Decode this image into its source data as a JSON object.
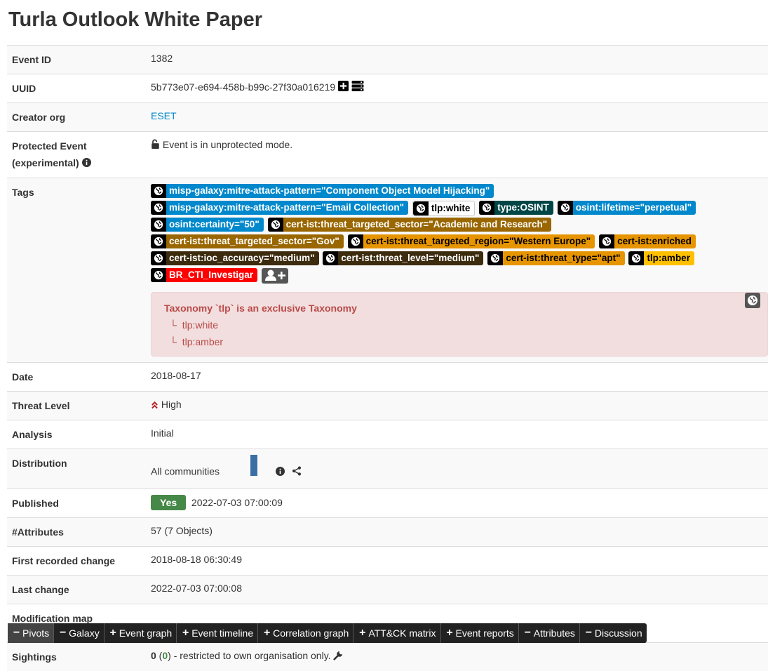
{
  "event": {
    "title": "Turla Outlook White Paper",
    "rows": {
      "event_id": {
        "key": "Event ID",
        "value": "1382"
      },
      "uuid": {
        "key": "UUID",
        "value": "5b773e07-e694-458b-b99c-27f30a016219"
      },
      "creator_org": {
        "key": "Creator org",
        "value": "ESET"
      },
      "protected": {
        "key_line1": "Protected Event",
        "key_line2": "(experimental)",
        "value": "Event is in unprotected mode."
      },
      "tags_key": "Tags",
      "date": {
        "key": "Date",
        "value": "2018-08-17"
      },
      "threat_level": {
        "key": "Threat Level",
        "value": "High"
      },
      "analysis": {
        "key": "Analysis",
        "value": "Initial"
      },
      "distribution": {
        "key": "Distribution",
        "value": "All communities"
      },
      "published": {
        "key": "Published",
        "badge": "Yes",
        "value": "2022-07-03 07:00:09"
      },
      "attributes": {
        "key": "#Attributes",
        "value": "57 (7 Objects)"
      },
      "first_change": {
        "key": "First recorded change",
        "value": "2018-08-18 06:30:49"
      },
      "last_change": {
        "key": "Last change",
        "value": "2022-07-03 07:00:08"
      },
      "modification_map": {
        "key": "Modification map"
      },
      "sightings": {
        "key": "Sightings",
        "count": "0",
        "paren_open": " (",
        "own": "0",
        "suffix": ") - restricted to own organisation only."
      }
    }
  },
  "tags": [
    {
      "label": "misp-galaxy:mitre-attack-pattern=\"Component Object Model Hijacking\"",
      "color": "#0088cc"
    },
    {
      "label": "misp-galaxy:mitre-attack-pattern=\"Email Collection\"",
      "color": "#0088cc"
    },
    {
      "label": "tlp:white",
      "color": "#ffffff"
    },
    {
      "label": "type:OSINT",
      "color": "#004646"
    },
    {
      "label": "osint:lifetime=\"perpetual\"",
      "color": "#0088cc"
    },
    {
      "label": "osint:certainty=\"50\"",
      "color": "#0088cc"
    },
    {
      "label": "cert-ist:threat_targeted_sector=\"Academic and Research\"",
      "color": "#996600"
    },
    {
      "label": "cert-ist:threat_targeted_sector=\"Gov\"",
      "color": "#996600"
    },
    {
      "label": "cert-ist:threat_targeted_region=\"Western Europe\"",
      "color": "#e69500"
    },
    {
      "label": "cert-ist:enriched",
      "color": "#e69500"
    },
    {
      "label": "cert-ist:ioc_accuracy=\"medium\"",
      "color": "#3d2b0e"
    },
    {
      "label": "cert-ist:threat_level=\"medium\"",
      "color": "#3d2b0e"
    },
    {
      "label": "cert-ist:threat_type=\"apt\"",
      "color": "#e69500"
    },
    {
      "label": "tlp:amber",
      "color": "#ffc000"
    },
    {
      "label": "BR_CTI_Investigar",
      "color": "#ff0000"
    }
  ],
  "taxonomy_alert": {
    "heading": "Taxonomy `tlp` is an exclusive Taxonomy",
    "items": [
      "tlp:white",
      "tlp:amber"
    ]
  },
  "tabs": [
    {
      "sign": "−",
      "label": "Pivots"
    },
    {
      "sign": "−",
      "label": "Galaxy"
    },
    {
      "sign": "+",
      "label": "Event graph"
    },
    {
      "sign": "+",
      "label": "Event timeline"
    },
    {
      "sign": "+",
      "label": "Correlation graph"
    },
    {
      "sign": "+",
      "label": "ATT&CK matrix"
    },
    {
      "sign": "+",
      "label": "Event reports"
    },
    {
      "sign": "−",
      "label": "Attributes"
    },
    {
      "sign": "−",
      "label": "Discussion"
    }
  ],
  "icons": {
    "uuid_actions": [
      "plus-square-icon",
      "server-icon"
    ],
    "protected": "unlock-icon",
    "info": "info-circle-icon",
    "threat": "chevron-double-up-icon",
    "share": "share-nodes-icon",
    "wrench": "wrench-icon",
    "globe": "globe-icon",
    "add_tag": "user-plus-icon"
  }
}
